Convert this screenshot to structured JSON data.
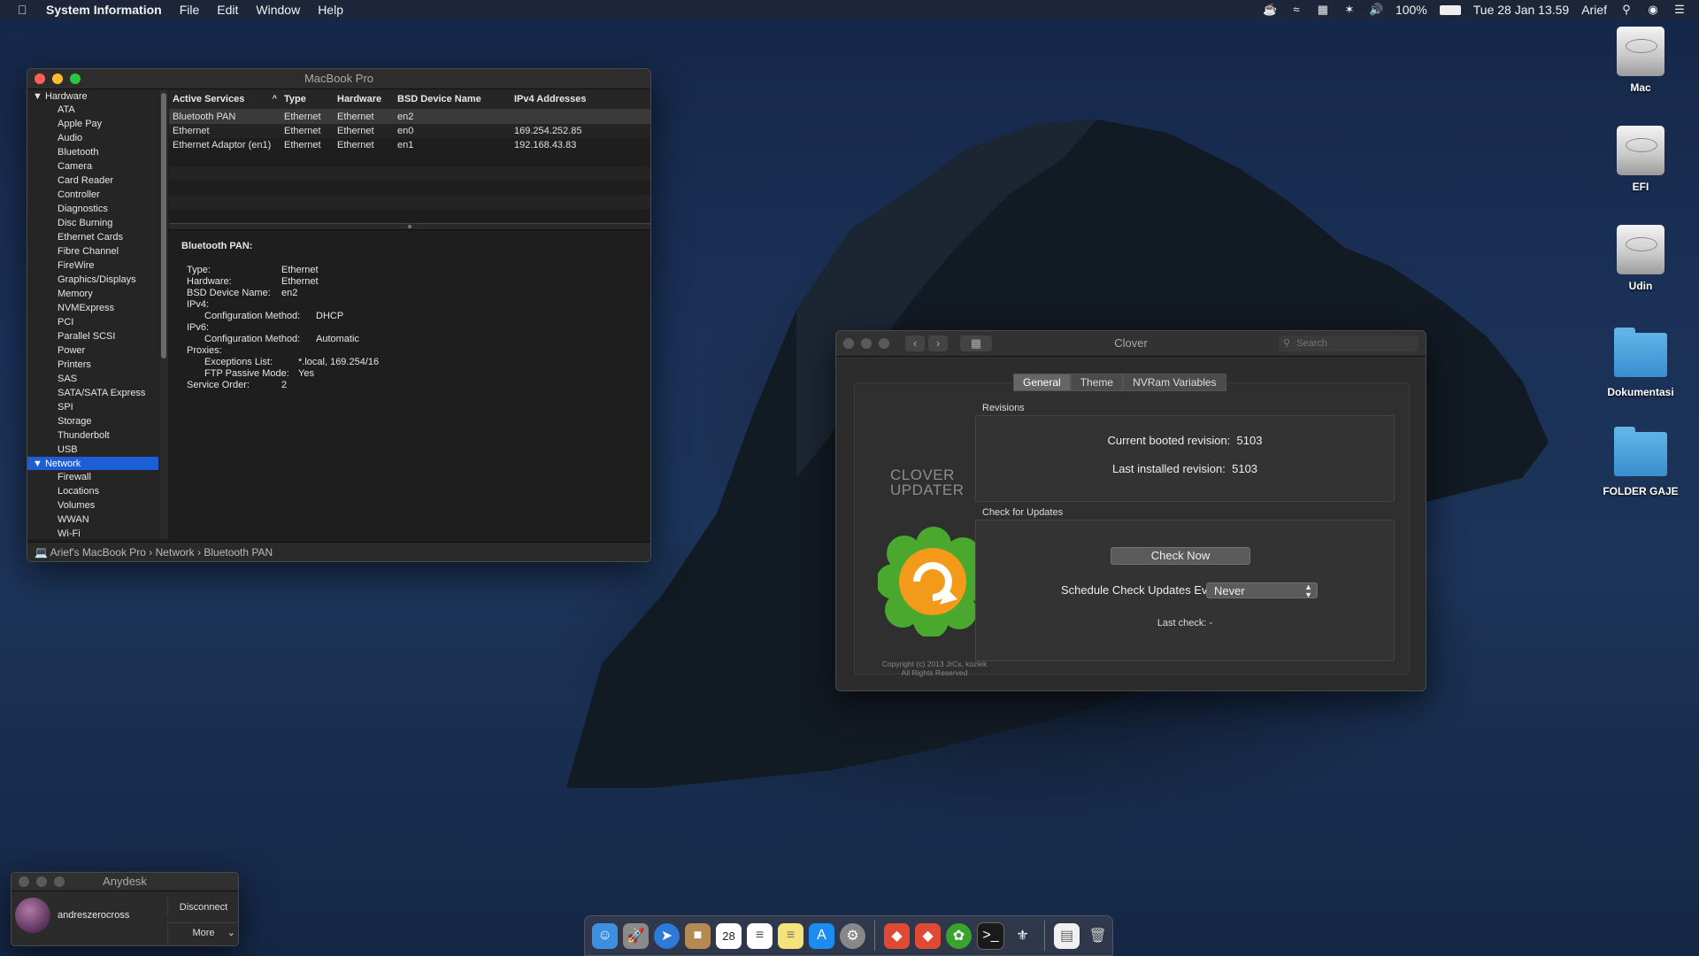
{
  "menubar": {
    "app_name": "System Information",
    "menus": [
      "File",
      "Edit",
      "Window",
      "Help"
    ],
    "battery": "100%",
    "datetime": "Tue 28 Jan  13.59",
    "user": "Arief"
  },
  "sysinfo": {
    "title": "MacBook Pro",
    "sidebar": {
      "hardware_group": "Hardware",
      "hardware_items": [
        "ATA",
        "Apple Pay",
        "Audio",
        "Bluetooth",
        "Camera",
        "Card Reader",
        "Controller",
        "Diagnostics",
        "Disc Burning",
        "Ethernet Cards",
        "Fibre Channel",
        "FireWire",
        "Graphics/Displays",
        "Memory",
        "NVMExpress",
        "PCI",
        "Parallel SCSI",
        "Power",
        "Printers",
        "SAS",
        "SATA/SATA Express",
        "SPI",
        "Storage",
        "Thunderbolt",
        "USB"
      ],
      "network_group": "Network",
      "network_items": [
        "Firewall",
        "Locations",
        "Volumes",
        "WWAN",
        "Wi-Fi"
      ]
    },
    "table": {
      "headers": [
        "Active Services",
        "Type",
        "Hardware",
        "BSD Device Name",
        "IPv4 Addresses"
      ],
      "rows": [
        [
          "Bluetooth PAN",
          "Ethernet",
          "Ethernet",
          "en2",
          ""
        ],
        [
          "Ethernet",
          "Ethernet",
          "Ethernet",
          "en0",
          "169.254.252.85"
        ],
        [
          "Ethernet Adaptor (en1)",
          "Ethernet",
          "Ethernet",
          "en1",
          "192.168.43.83"
        ]
      ]
    },
    "detail": {
      "title": "Bluetooth PAN:",
      "type_label": "Type:",
      "type_value": "Ethernet",
      "hardware_label": "Hardware:",
      "hardware_value": "Ethernet",
      "bsd_label": "BSD Device Name:",
      "bsd_value": "en2",
      "ipv4_label": "IPv4:",
      "ipv4_cfg_label": "Configuration Method:",
      "ipv4_cfg_value": "DHCP",
      "ipv6_label": "IPv6:",
      "ipv6_cfg_label": "Configuration Method:",
      "ipv6_cfg_value": "Automatic",
      "proxies_label": "Proxies:",
      "exceptions_label": "Exceptions List:",
      "exceptions_value": "*.local, 169.254/16",
      "ftp_label": "FTP Passive Mode:",
      "ftp_value": "Yes",
      "order_label": "Service Order:",
      "order_value": "2"
    },
    "breadcrumb": {
      "computer": "Arief's MacBook Pro",
      "sep": "›",
      "section": "Network",
      "item": "Bluetooth PAN"
    }
  },
  "clover": {
    "title": "Clover",
    "search_placeholder": "Search",
    "tabs": [
      "General",
      "Theme",
      "NVRam Variables"
    ],
    "logo_line1": "CLOVER",
    "logo_line2": "UPDATER",
    "copyright_line1": "Copyright (c) 2013 JrCs, kozlek",
    "copyright_line2": "All Rights Reserved",
    "revisions_label": "Revisions",
    "current_label": "Current booted revision:",
    "current_value": "5103",
    "installed_label": "Last installed revision:",
    "installed_value": "5103",
    "updates_label": "Check for Updates",
    "check_now": "Check Now",
    "schedule_label": "Schedule Check Updates Every:",
    "schedule_value": "Never",
    "last_check": "Last check: -"
  },
  "anydesk": {
    "title": "Anydesk",
    "user": "andreszerocross",
    "disconnect": "Disconnect",
    "more": "More"
  },
  "desktop": {
    "icons": [
      {
        "label": "Mac",
        "kind": "disk"
      },
      {
        "label": "EFI",
        "kind": "disk"
      },
      {
        "label": "Udin",
        "kind": "disk"
      },
      {
        "label": "Dokumentasi",
        "kind": "folder"
      },
      {
        "label": "FOLDER GAJE",
        "kind": "folder"
      }
    ]
  },
  "dock": {
    "apps": [
      "finder-icon",
      "launchpad-icon",
      "safari-icon",
      "contacts-icon",
      "calendar-icon",
      "reminders-icon",
      "notes-icon",
      "app-store-icon",
      "system-preferences-icon",
      "git-icon",
      "git-tool-icon",
      "clover-icon",
      "terminal-icon",
      "utility-icon",
      "document-icon",
      "trash-icon"
    ],
    "calendar_day": "28",
    "colors": {
      "finder": "#3d8fe0",
      "safari": "#2d7ad8",
      "notes": "#f5e27a",
      "appstore": "#1d8cf0",
      "git": "#e04a35",
      "clover": "#3aa32b",
      "terminal": "#1a1a1a"
    }
  }
}
